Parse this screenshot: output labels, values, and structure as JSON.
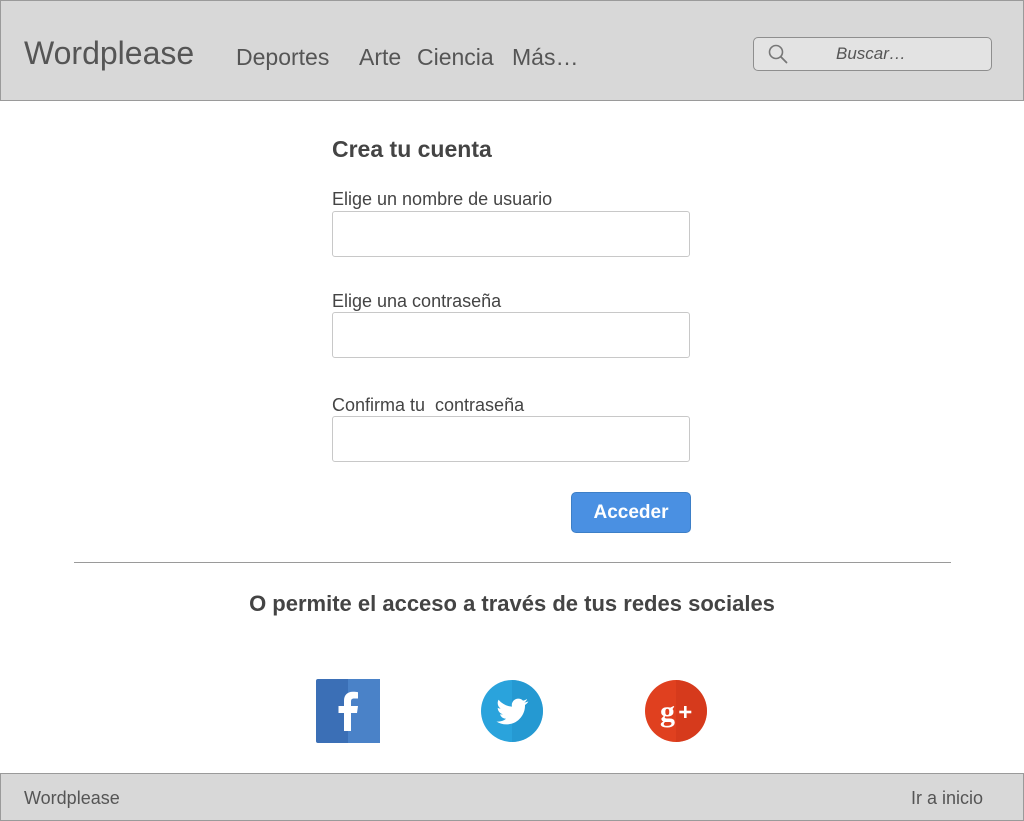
{
  "header": {
    "brand": "Wordplease",
    "nav": [
      "Deportes",
      "Arte",
      "Ciencia",
      "Más…"
    ],
    "search": {
      "placeholder": "Buscar…",
      "value": ""
    }
  },
  "form": {
    "title": "Crea tu cuenta",
    "fields": [
      {
        "label": "Elige un nombre de usuario",
        "value": ""
      },
      {
        "label": "Elige una contraseña",
        "value": ""
      },
      {
        "label": "Confirma tu  contraseña",
        "value": ""
      }
    ],
    "submit_label": "Acceder"
  },
  "social": {
    "heading": "O permite el acceso a través de tus redes sociales",
    "networks": [
      {
        "icon": "facebook-icon",
        "color": "#3b6fb6"
      },
      {
        "icon": "twitter-icon",
        "color": "#2aa3dc"
      },
      {
        "icon": "google-plus-icon",
        "color": "#e0401f"
      }
    ]
  },
  "footer": {
    "brand": "Wordplease",
    "home_link": "Ir a inicio"
  },
  "colors": {
    "bar_background": "#d8d8d8",
    "accent_button": "#4a90e2",
    "text": "#444444"
  }
}
